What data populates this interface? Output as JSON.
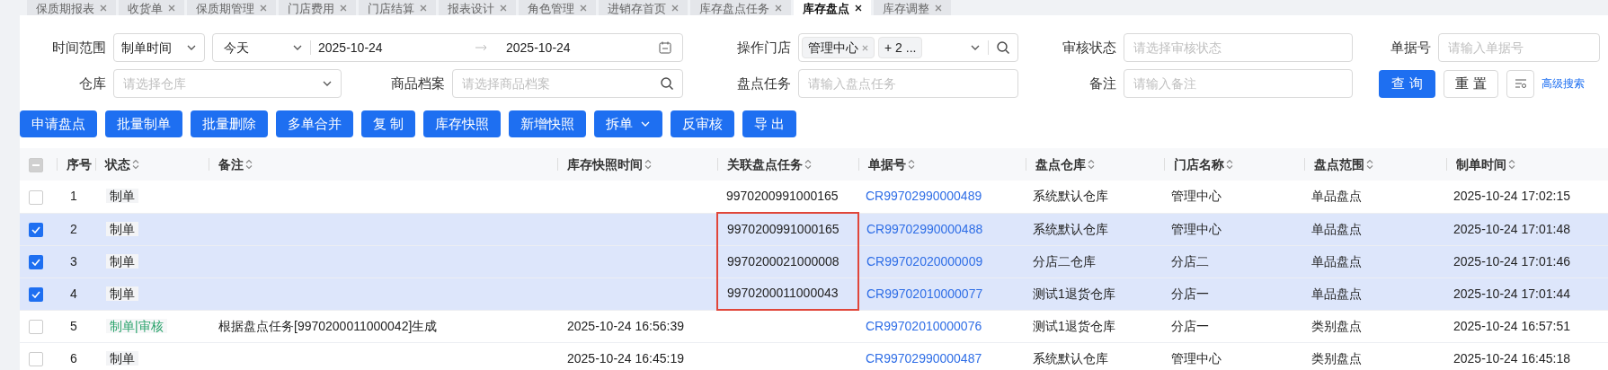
{
  "tabs": [
    {
      "label": "保质期报表",
      "selected": false
    },
    {
      "label": "收货单",
      "selected": false
    },
    {
      "label": "保质期管理",
      "selected": false
    },
    {
      "label": "门店费用",
      "selected": false
    },
    {
      "label": "门店结算",
      "selected": false
    },
    {
      "label": "报表设计",
      "selected": false
    },
    {
      "label": "角色管理",
      "selected": false
    },
    {
      "label": "进销存首页",
      "selected": false
    },
    {
      "label": "库存盘点任务",
      "selected": false
    },
    {
      "label": "库存盘点",
      "selected": true
    },
    {
      "label": "库存调整",
      "selected": false
    }
  ],
  "filters": {
    "time_range": {
      "label": "时间范围",
      "type": "制单时间",
      "period": "今天",
      "start": "2025-10-24",
      "end": "2025-10-24"
    },
    "store": {
      "label": "操作门店",
      "tags": [
        "管理中心"
      ],
      "more": "+ 2 ..."
    },
    "review_status": {
      "label": "审核状态",
      "placeholder": "请选择审核状态"
    },
    "doc_no": {
      "label": "单据号",
      "placeholder": "请输入单据号"
    },
    "warehouse": {
      "label": "仓库",
      "placeholder": "请选择仓库"
    },
    "product": {
      "label": "商品档案",
      "placeholder": "请选择商品档案"
    },
    "task": {
      "label": "盘点任务",
      "placeholder": "请输入盘点任务"
    },
    "remark": {
      "label": "备注",
      "placeholder": "请输入备注"
    }
  },
  "search_buttons": {
    "query": "查 询",
    "reset": "重 置",
    "advanced": "高级搜索"
  },
  "actions": [
    {
      "label": "申请盘点",
      "dropdown": false
    },
    {
      "label": "批量制单",
      "dropdown": false
    },
    {
      "label": "批量删除",
      "dropdown": false
    },
    {
      "label": "多单合并",
      "dropdown": false
    },
    {
      "label": "复 制",
      "dropdown": false
    },
    {
      "label": "库存快照",
      "dropdown": false
    },
    {
      "label": "新增快照",
      "dropdown": false
    },
    {
      "label": "拆单",
      "dropdown": true
    },
    {
      "label": "反审核",
      "dropdown": false
    },
    {
      "label": "导 出",
      "dropdown": false
    }
  ],
  "table": {
    "select_all_indeterminate": true,
    "columns": [
      {
        "label": "序号",
        "sortable": false
      },
      {
        "label": "状态",
        "sortable": true
      },
      {
        "label": "备注",
        "sortable": true
      },
      {
        "label": "库存快照时间",
        "sortable": true
      },
      {
        "label": "关联盘点任务",
        "sortable": true
      },
      {
        "label": "单据号",
        "sortable": true
      },
      {
        "label": "盘点仓库",
        "sortable": true
      },
      {
        "label": "门店名称",
        "sortable": true
      },
      {
        "label": "盘点范围",
        "sortable": true
      },
      {
        "label": "制单时间",
        "sortable": true
      }
    ],
    "rows": [
      {
        "checked": false,
        "seq": "1",
        "status": {
          "text": "制单",
          "kind": "draft"
        },
        "remark": "",
        "snapshot_time": "",
        "task": "9970200991000165",
        "task_framed": false,
        "doc_no": "CR99702990000489",
        "warehouse": "系统默认仓库",
        "store": "管理中心",
        "scope": "单品盘点",
        "created": "2025-10-24 17:02:15"
      },
      {
        "checked": true,
        "seq": "2",
        "status": {
          "text": "制单",
          "kind": "draft"
        },
        "remark": "",
        "snapshot_time": "",
        "task": "9970200991000165",
        "task_framed": true,
        "doc_no": "CR99702990000488",
        "warehouse": "系统默认仓库",
        "store": "管理中心",
        "scope": "单品盘点",
        "created": "2025-10-24 17:01:48"
      },
      {
        "checked": true,
        "seq": "3",
        "status": {
          "text": "制单",
          "kind": "draft"
        },
        "remark": "",
        "snapshot_time": "",
        "task": "9970200021000008",
        "task_framed": true,
        "doc_no": "CR99702020000009",
        "warehouse": "分店二仓库",
        "store": "分店二",
        "scope": "单品盘点",
        "created": "2025-10-24 17:01:46"
      },
      {
        "checked": true,
        "seq": "4",
        "status": {
          "text": "制单",
          "kind": "draft"
        },
        "remark": "",
        "snapshot_time": "",
        "task": "9970200011000043",
        "task_framed": true,
        "doc_no": "CR99702010000077",
        "warehouse": "测试1退货仓库",
        "store": "分店一",
        "scope": "单品盘点",
        "created": "2025-10-24 17:01:44"
      },
      {
        "checked": false,
        "seq": "5",
        "status": {
          "text": "制单|审核",
          "kind": "reviewed"
        },
        "remark": "根据盘点任务[9970200011000042]生成",
        "snapshot_time": "2025-10-24 16:56:39",
        "task": "",
        "task_framed": false,
        "doc_no": "CR99702010000076",
        "warehouse": "测试1退货仓库",
        "store": "分店一",
        "scope": "类别盘点",
        "created": "2025-10-24 16:57:51"
      },
      {
        "checked": false,
        "seq": "6",
        "status": {
          "text": "制单",
          "kind": "draft"
        },
        "remark": "",
        "snapshot_time": "2025-10-24 16:45:19",
        "task": "",
        "task_framed": false,
        "doc_no": "CR99702990000487",
        "warehouse": "系统默认仓库",
        "store": "管理中心",
        "scope": "类别盘点",
        "created": "2025-10-24 16:45:18"
      }
    ]
  }
}
